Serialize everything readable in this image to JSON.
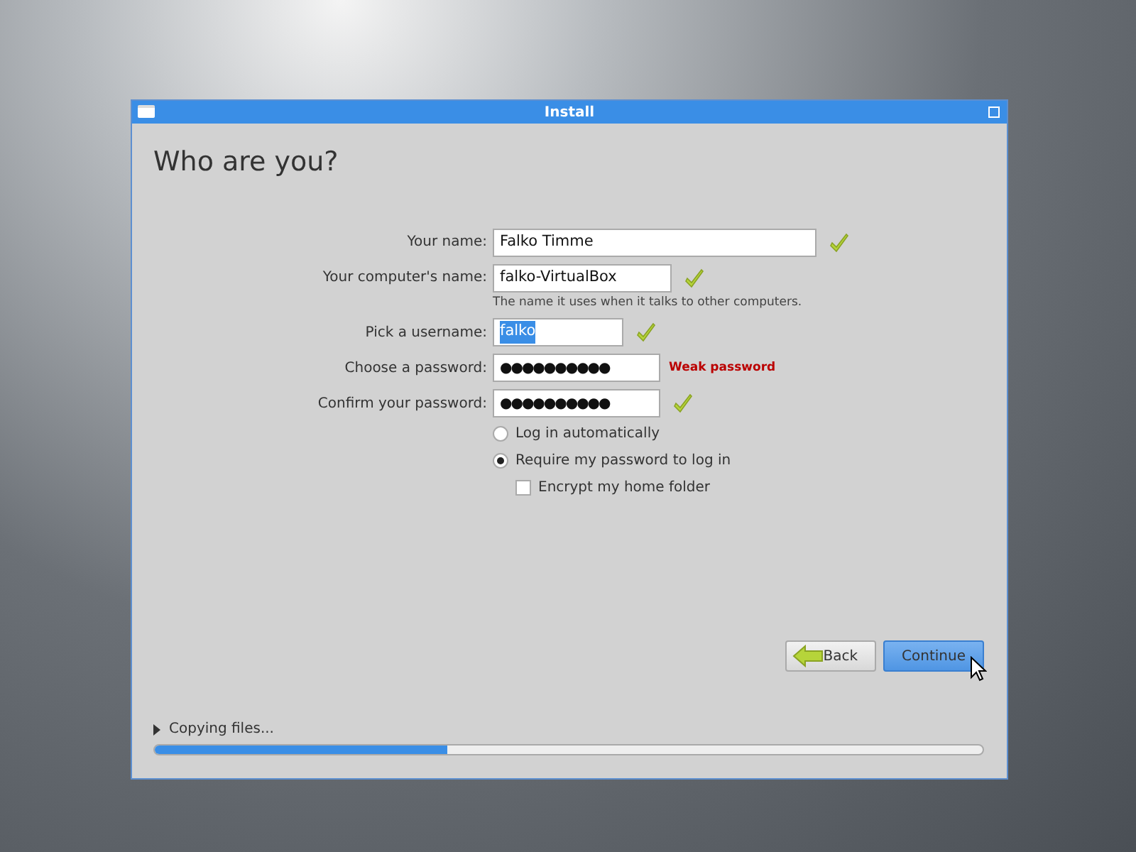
{
  "window": {
    "title": "Install"
  },
  "heading": "Who are you?",
  "fields": [
    {
      "label": "Your name:",
      "kind": "text",
      "value": "Falko Timme",
      "valid": true,
      "text_selected": false
    },
    {
      "label": "Your computer's name:",
      "kind": "text",
      "value": "falko-VirtualBox",
      "valid": true,
      "text_selected": false,
      "hint": "The name it uses when it talks to other computers."
    },
    {
      "label": "Pick a username:",
      "kind": "text",
      "value": "falko",
      "valid": true,
      "text_selected": true
    },
    {
      "label": "Choose a password:",
      "kind": "password",
      "value": "●●●●●●●●●●",
      "valid": false,
      "text_selected": false,
      "strength": "Weak password"
    },
    {
      "label": "Confirm your password:",
      "kind": "password",
      "value": "●●●●●●●●●●",
      "valid": true,
      "text_selected": false
    }
  ],
  "login_options": [
    {
      "kind": "radio",
      "label": "Log in automatically",
      "selected": false
    },
    {
      "kind": "radio",
      "label": "Require my password to log in",
      "selected": true
    },
    {
      "kind": "checkbox",
      "label": "Encrypt my home folder",
      "checked": false
    }
  ],
  "buttons": [
    {
      "kind": "back",
      "label": "Back",
      "focused": false
    },
    {
      "kind": "continue",
      "label": "Continue",
      "focused": true
    }
  ],
  "progress": {
    "label": "Copying files...",
    "expanded": false,
    "level": 0.354
  }
}
